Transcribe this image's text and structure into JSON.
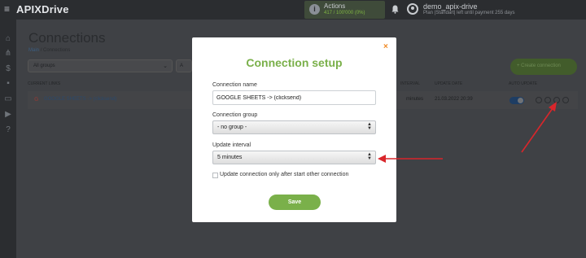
{
  "app": {
    "logo": "APIXDrive"
  },
  "topbar": {
    "actions_label": "Actions",
    "actions_value": "417 / 100'000 (0%)",
    "user_name": "demo_apix-drive",
    "user_plan": "Plan |Standart| left until payment 255 days"
  },
  "page": {
    "title": "Connections",
    "breadcrumb_main": "Main",
    "breadcrumb_sep": "/",
    "breadcrumb_current": "Connections",
    "groups_filter": "All groups",
    "search_fragment": "A",
    "create_button": "+ Create connection"
  },
  "table": {
    "headers": {
      "links": "CURRENT LINKS",
      "interval": "INTERVAL",
      "update_date": "UPDATE DATE",
      "auto_update": "AUTO UPDATE"
    },
    "rows": [
      {
        "icon_letter": "G",
        "name": "GOOGLE SHEETS -> (clicksend)",
        "interval": "minutes",
        "update_date": "21.03.2022 20:39"
      }
    ]
  },
  "modal": {
    "close_symbol": "×",
    "title": "Connection setup",
    "name_label": "Connection name",
    "name_value": "GOOGLE SHEETS -> (clicksend)",
    "group_label": "Connection group",
    "group_value": "- no group -",
    "interval_label": "Update interval",
    "interval_value": "5 minutes",
    "checkbox_label": "Update connection only after start other connection",
    "save_button": "Save"
  },
  "colors": {
    "accent_green": "#7ab04a",
    "close_orange": "#f08a24",
    "annotation_red": "#d9262b"
  }
}
